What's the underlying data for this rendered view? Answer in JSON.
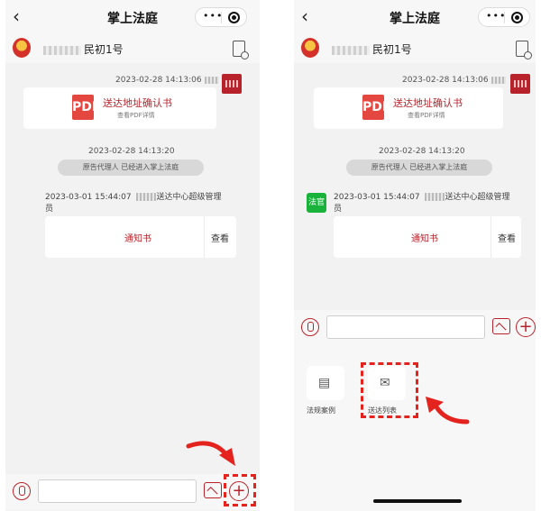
{
  "app": {
    "title": "掌上法庭"
  },
  "case": {
    "number": "民初1号"
  },
  "messages": {
    "pdf": {
      "timestamp": "2023-02-28 14:13:06",
      "title": "送达地址确认书",
      "subtitle": "查看PDF详情",
      "icon": "PDF"
    },
    "system": {
      "timestamp": "2023-02-28 14:13:20",
      "notice": "原告代理人 已经进入掌上法庭"
    },
    "notice": {
      "timestamp": "2023-03-01 15:44:07",
      "sender_left": "送达中心超级管理",
      "sender_right": "员",
      "title": "通知书",
      "action": "查看"
    }
  },
  "badge": {
    "label": "法官"
  },
  "panel": {
    "items": [
      {
        "label": "法规案例",
        "icon": "book-icon"
      },
      {
        "label": "送达列表",
        "icon": "envelope-icon"
      }
    ]
  },
  "colors": {
    "accent": "#b8232b",
    "highlight": "#e4231f",
    "badge": "#19b23b"
  }
}
